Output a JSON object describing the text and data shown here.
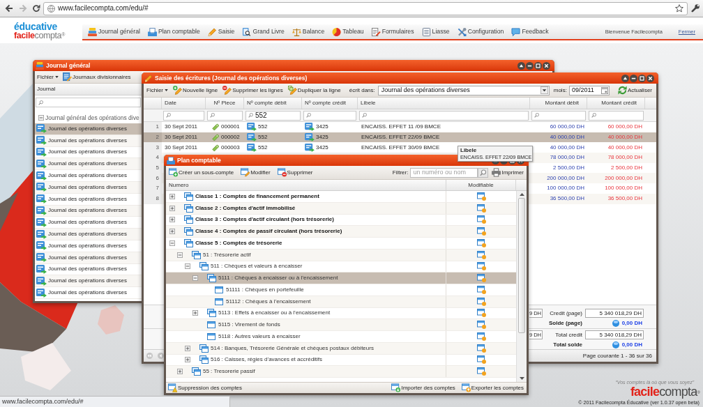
{
  "browser": {
    "url": "www.facilecompta.com/edu/#",
    "status_text": "www.facilecompta.com/edu/#"
  },
  "header": {
    "logo_top": "éducative",
    "logo_wordmark": "**facile**compta$^{®}$",
    "nav": [
      "Journal général",
      "Plan comptable",
      "Saisie",
      "Grand Livre",
      "Balance",
      "Tableau",
      "Formulaires",
      "Liasse",
      "Configuration",
      "Feedback"
    ],
    "welcome": "Bienvenue Facilecompta",
    "logout": "Fermer"
  },
  "journal_window": {
    "title": "Journal général",
    "menu": "Fichier",
    "toolbar_button": "Journaux divisionnaires",
    "column": "Journal",
    "group": {
      "label": "Journal général des opérations dive",
      "expanded": true
    },
    "items": [
      {
        "label": "Journal des opérations diverses",
        "selected": true
      },
      {
        "label": "Journal des opérations diverses",
        "selected": false
      },
      {
        "label": "Journal des opérations diverses",
        "selected": false
      },
      {
        "label": "Journal des opérations diverses",
        "selected": false
      },
      {
        "label": "Journal des opérations diverses",
        "selected": false
      },
      {
        "label": "Journal des opérations diverses",
        "selected": false
      },
      {
        "label": "Journal des opérations diverses",
        "selected": false
      },
      {
        "label": "Journal des opérations diverses",
        "selected": false
      },
      {
        "label": "Journal des opérations diverses",
        "selected": false
      },
      {
        "label": "Journal des opérations diverses",
        "selected": false
      },
      {
        "label": "Journal des opérations diverses",
        "selected": false
      },
      {
        "label": "Journal des opérations diverses",
        "selected": false
      },
      {
        "label": "Journal des opérations diverses",
        "selected": false
      },
      {
        "label": "Journal des opérations diverses",
        "selected": false
      },
      {
        "label": "Journal des opérations diverses",
        "selected": false
      }
    ]
  },
  "entry_window": {
    "title": "Saisie des écritures (Journal des opérations diverses)",
    "menu": "Fichier",
    "actions": [
      "Nouvelle ligne",
      "Supprimer les lignes",
      "Dupliquer la ligne"
    ],
    "journal_label": "écrit dans:",
    "journal_value": "Journal des opérations diverses",
    "month_label": "mois:",
    "month_value": "09/2011",
    "refresh": "Actualiser",
    "columns": [
      "Date",
      "Nº Piece",
      "Nº compte débit",
      "Nº compte crédit",
      "Libele",
      "Montant débit",
      "Montant crédit"
    ],
    "debit_account_filter": "552",
    "rows": [
      {
        "number": "1",
        "date": "30 Sept 2011",
        "piece": "000001",
        "debit_account": "552",
        "credit_account": "3425",
        "label": "ENCAISS. EFFET 11 /09 BMCE",
        "debit": "60 000,00 DH",
        "credit": "60 000,00 DH",
        "selected": false
      },
      {
        "number": "2",
        "date": "30 Sept 2011",
        "piece": "000002",
        "debit_account": "552",
        "credit_account": "3425",
        "label": "ENCAISS. EFFET 22/09 BMCE",
        "debit": "40 000,00 DH",
        "credit": "40 000,00 DH",
        "selected": true
      },
      {
        "number": "3",
        "date": "30 Sept 2011",
        "piece": "000003",
        "debit_account": "552",
        "credit_account": "3425",
        "label": "ENCAISS. EFFET 30/09 BMCE",
        "debit": "40 000,00 DH",
        "credit": "40 000,00 DH",
        "selected": false
      },
      {
        "number": "4",
        "debit": "78 000,00 DH",
        "credit": "78 000,00 DH",
        "selected": false
      },
      {
        "number": "5",
        "debit": "2 500,00 DH",
        "credit": "2 500,00 DH",
        "selected": false
      },
      {
        "number": "6",
        "debit": "200 000,00 DH",
        "credit": "200 000,00 DH",
        "selected": false
      },
      {
        "number": "7",
        "debit": "100 000,00 DH",
        "credit": "100 000,00 DH",
        "selected": false
      },
      {
        "number": "8",
        "debit": "36 500,00 DH",
        "credit": "36 500,00 DH",
        "selected": false
      }
    ],
    "summary": [
      {
        "left_field": "9 DH",
        "label": "Credit (page)",
        "value": "5 340 018,29 DH",
        "balance_label": "Solde (page)",
        "balance": "0,00 DH"
      },
      {
        "left_field": "9 DH",
        "label": "Total credit",
        "value": "5 340 018,29 DH",
        "balance_label": "Total solde",
        "balance": "0,00 DH"
      }
    ],
    "paging": "Page courante 1 - 36 sur 36"
  },
  "tooltip": {
    "title": "Libele",
    "text": "ENCAISS. EFFET 22/09 BMCE"
  },
  "accounts_window": {
    "title": "Plan comptable",
    "actions": [
      "Créer un sous-compte",
      "Modifier",
      "Supprimer"
    ],
    "filter_label": "Filtrer:",
    "filter_placeholder": "un numéro ou nom",
    "print": "Imprimer",
    "columns": [
      "Numero",
      "Modifiable"
    ],
    "tree": [
      {
        "kind": "folder",
        "label": "Classe 1 : Comptes de financement permanent",
        "expanded": false,
        "selected": false
      },
      {
        "kind": "folder",
        "label": "Classe 2 : Comptes d'actif immobilisé",
        "expanded": false,
        "selected": false
      },
      {
        "kind": "folder",
        "label": "Classe 3 : Comptes d'actif circulant (hors trésorerie)",
        "expanded": false,
        "selected": false
      },
      {
        "kind": "folder",
        "label": "Classe 4 : Comptes de passif circulant (hors trésorerie)",
        "expanded": false,
        "selected": false
      },
      {
        "kind": "folder",
        "label": "Classe 5 : Comptes de trésorerie",
        "expanded": true,
        "selected": false,
        "children": [
          {
            "kind": "folder",
            "label": "51 : Trésorerie actif",
            "expanded": true,
            "selected": false,
            "children": [
              {
                "kind": "folder",
                "label": "511 : Chèques et valeurs à encaisser",
                "expanded": true,
                "selected": false,
                "children": [
                  {
                    "kind": "folder",
                    "label": "5111 : Chèques à encaisser ou à l’encaissement",
                    "expanded": true,
                    "selected": true,
                    "children": [
                      {
                        "kind": "leaf",
                        "label": "51111 : Chèques en portefeuille",
                        "selected": false
                      },
                      {
                        "kind": "leaf",
                        "label": "51112 : Chèques à l’encaissement",
                        "selected": false
                      }
                    ]
                  },
                  {
                    "kind": "folder",
                    "label": "5113 : Effets à encaisser ou à l’encaissement",
                    "expanded": false,
                    "selected": false
                  },
                  {
                    "kind": "leaf",
                    "label": "5115 : Virement de fonds",
                    "selected": false
                  },
                  {
                    "kind": "leaf",
                    "label": "5118 : Autres valeurs à encaisser",
                    "selected": false
                  }
                ]
              },
              {
                "kind": "folder",
                "label": "514 : Banques, Trésorerie Générale et chèques postaux débiteurs",
                "expanded": false,
                "selected": false
              },
              {
                "kind": "folder",
                "label": "516 : Caisses, régies d’avances et accréditifs",
                "expanded": false,
                "selected": false
              }
            ]
          },
          {
            "kind": "folder",
            "label": "55 : Tresorerie passif",
            "expanded": false,
            "selected": false
          }
        ]
      }
    ],
    "footer_left": "Suppression des comptes",
    "footer_right": [
      "Importer des comptes",
      "Exporter les comptes"
    ]
  },
  "footer": {
    "tagline": "“Vos comptes là où que vous soyez”",
    "wordmark": "**facile**compta$^{®}$",
    "copyright": "© 2011 Facilecompta Éducative (ver 1.0.37 open beta)"
  }
}
